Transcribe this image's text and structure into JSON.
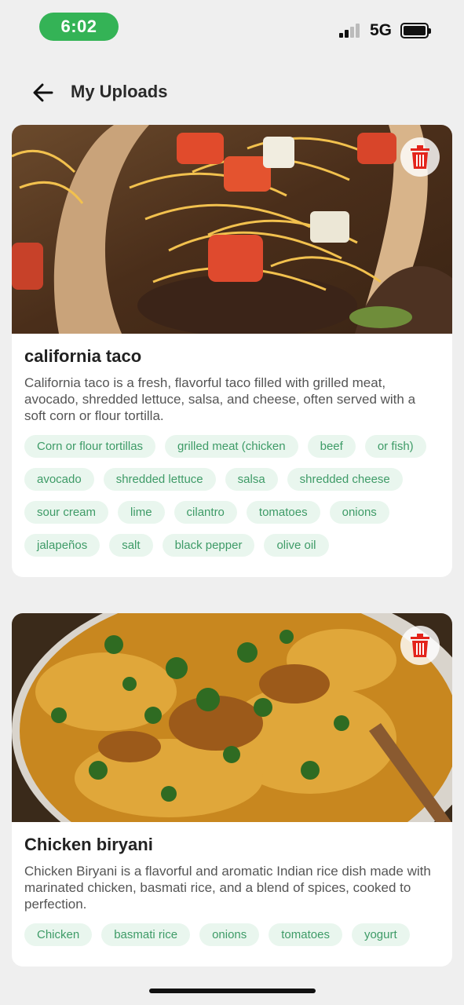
{
  "status_bar": {
    "time": "6:02",
    "network": "5G",
    "time_pill_color": "#34b356"
  },
  "header": {
    "title": "My Uploads",
    "back_icon": "arrow-left-icon"
  },
  "uploads": [
    {
      "title": "california taco",
      "description": "California taco is a fresh, flavorful taco filled with grilled meat, avocado, shredded lettuce, salsa, and cheese, often served with a soft corn or flour tortilla.",
      "delete_icon": "trash-icon",
      "image_alt": "taco-photo",
      "tags": [
        "Corn or flour tortillas",
        "grilled meat (chicken",
        "beef",
        "or fish)",
        "avocado",
        "shredded lettuce",
        "salsa",
        "shredded cheese",
        "sour cream",
        "lime",
        "cilantro",
        "tomatoes",
        "onions",
        "jalapeños",
        "salt",
        "black pepper",
        "olive oil"
      ]
    },
    {
      "title": "Chicken biryani",
      "description": "Chicken Biryani is a flavorful and aromatic Indian rice dish made with marinated chicken, basmati rice, and a blend of spices, cooked to perfection.",
      "delete_icon": "trash-icon",
      "image_alt": "biryani-photo",
      "tags": [
        "Chicken",
        "basmati rice",
        "onions",
        "tomatoes",
        "yogurt"
      ]
    }
  ],
  "colors": {
    "tag_bg": "#e9f6ee",
    "tag_text": "#3e9b67",
    "delete_red": "#e3241b"
  }
}
